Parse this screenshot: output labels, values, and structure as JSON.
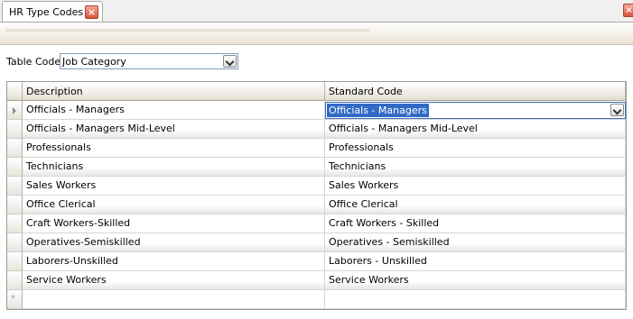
{
  "tab": {
    "title": "HR Type Codes",
    "close_glyph": "×"
  },
  "window": {
    "close_glyph": "×"
  },
  "filter": {
    "label": "Table Code",
    "value": "Job Category"
  },
  "grid": {
    "columns": [
      "Description",
      "Standard Code"
    ],
    "rows": [
      {
        "description": "Officials - Managers",
        "standard": "Officials - Managers"
      },
      {
        "description": "Officials - Managers Mid-Level",
        "standard": "Officials - Managers Mid-Level"
      },
      {
        "description": "Professionals",
        "standard": "Professionals"
      },
      {
        "description": "Technicians",
        "standard": "Technicians"
      },
      {
        "description": "Sales Workers",
        "standard": "Sales Workers"
      },
      {
        "description": "Office Clerical",
        "standard": "Office Clerical"
      },
      {
        "description": "Craft Workers-Skilled",
        "standard": "Craft Workers - Skilled"
      },
      {
        "description": "Operatives-Semiskilled",
        "standard": "Operatives - Semiskilled"
      },
      {
        "description": "Laborers-Unskilled",
        "standard": "Laborers - Unskilled"
      },
      {
        "description": "Service Workers",
        "standard": "Service Workers"
      }
    ],
    "new_row_glyph": "*",
    "active_row_editor_value": "Officials - Managers"
  },
  "colors": {
    "selection": "#316ac5",
    "close_button": "#d9543c"
  }
}
